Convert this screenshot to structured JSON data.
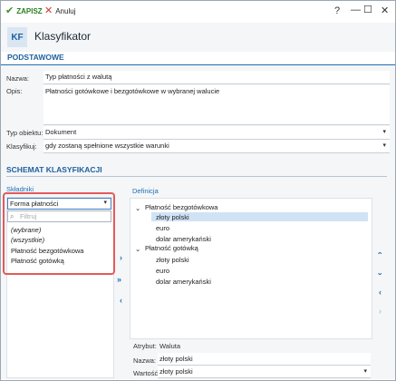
{
  "toolbar": {
    "save_label": "ZAPISZ",
    "cancel_label": "Anuluj",
    "help": "?"
  },
  "header": {
    "badge": "KF",
    "title": "Klasyfikator"
  },
  "tabs": {
    "active": "PODSTAWOWE"
  },
  "form": {
    "name_label": "Nazwa:",
    "name_value": "Typ płatności z walutą",
    "desc_label": "Opis:",
    "desc_value": "Płatności gotówkowe i bezgotówkowe w wybranej walucie",
    "type_label": "Typ obiektu:",
    "type_value": "Dokument",
    "class_label": "Klasyfikuj:",
    "class_value": "gdy zostaną spełnione wszystkie warunki"
  },
  "schema": {
    "title": "SCHEMAT KLASYFIKACJI",
    "components_label": "Składniki",
    "definition_label": "Definicja",
    "combo_value": "Forma płatności",
    "search_placeholder": "Filtruj",
    "options": [
      "(wybrane)",
      "(wszystkie)",
      "Płatność bezgotówkowa",
      "Płatność gotówką"
    ],
    "tree": {
      "group1": "Płatność bezgotówkowa",
      "group1_items": [
        "złoty polski",
        "euro",
        "dolar amerykański"
      ],
      "group2": "Płatność gotówką",
      "group2_items": [
        "złoty polski",
        "euro",
        "dolar amerykański"
      ]
    },
    "attr_label": "Atrybut:",
    "attr_value": "Waluta",
    "name2_label": "Nazwa:",
    "name2_value": "złoty polski",
    "value_label": "Wartość:",
    "value_value": "złoty polski"
  }
}
